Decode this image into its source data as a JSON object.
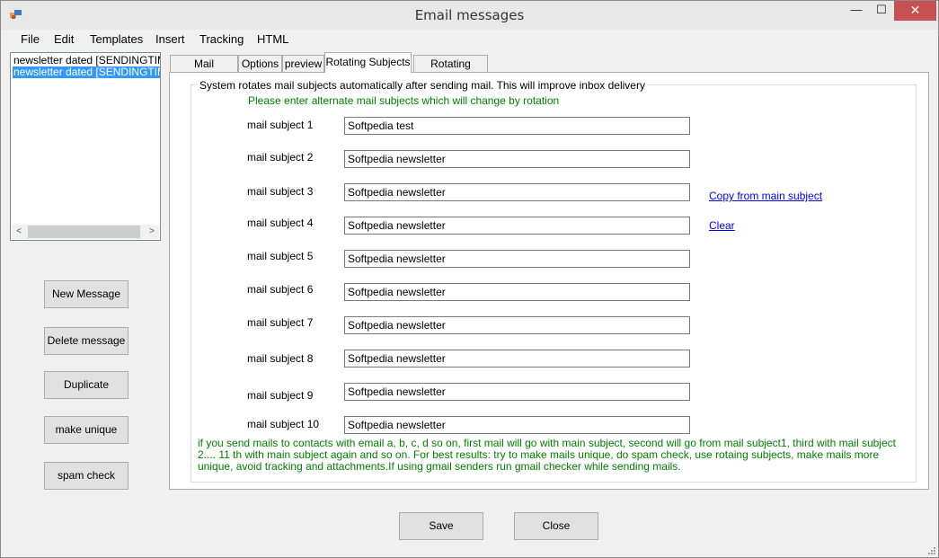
{
  "window": {
    "title": "Email messages",
    "minimize": "—",
    "maximize": "☐",
    "close": "✕"
  },
  "menu": [
    "File",
    "Edit",
    "Templates",
    "Insert",
    "Tracking",
    "HTML"
  ],
  "message_list": [
    "newsletter dated [SENDINGTIME]",
    "newsletter dated [SENDINGTIME]"
  ],
  "side_buttons": {
    "new_message": "New Message",
    "delete_message": "Delete message",
    "duplicate": "Duplicate",
    "make_unique": "make unique",
    "spam_check": "spam check"
  },
  "tabs": [
    "Mail Message",
    "Options",
    "preview",
    "Rotating Subjects",
    "Rotating Bodies"
  ],
  "rotating": {
    "group_caption": "System rotates mail subjects automatically after sending mail. This will improve inbox delivery",
    "hint": "Please enter alternate mail subjects which will change by rotation",
    "subjects": [
      {
        "label": "mail subject 1",
        "value": "Softpedia test"
      },
      {
        "label": "mail subject 2",
        "value": "Softpedia newsletter"
      },
      {
        "label": "mail subject 3",
        "value": "Softpedia newsletter"
      },
      {
        "label": "mail subject 4",
        "value": "Softpedia newsletter"
      },
      {
        "label": "mail subject 5",
        "value": "Softpedia newsletter"
      },
      {
        "label": "mail subject 6",
        "value": "Softpedia newsletter"
      },
      {
        "label": "mail subject 7",
        "value": "Softpedia newsletter"
      },
      {
        "label": "mail subject 8",
        "value": "Softpedia newsletter"
      },
      {
        "label": "mail subject 9",
        "value": "Softpedia newsletter"
      },
      {
        "label": "mail subject 10",
        "value": "Softpedia newsletter"
      }
    ],
    "copy_link": "Copy from main subject",
    "clear_link": "Clear",
    "note": "if you send mails to contacts with email a, b, c, d so on, first mail will go with main subject, second will go from mail subject1, third with mail subject 2....  11 th with main subject again and so on. For best results: try to make mails unique, do spam check, use rotaing subjects, make mails more unique, avoid tracking and attachments.If using gmail senders run gmail checker while sending mails."
  },
  "footer": {
    "save": "Save",
    "close": "Close"
  },
  "colors": {
    "accent_green": "#008000",
    "link_blue": "#0000ff",
    "selection": "#3399ff",
    "close_red": "#c75050"
  }
}
